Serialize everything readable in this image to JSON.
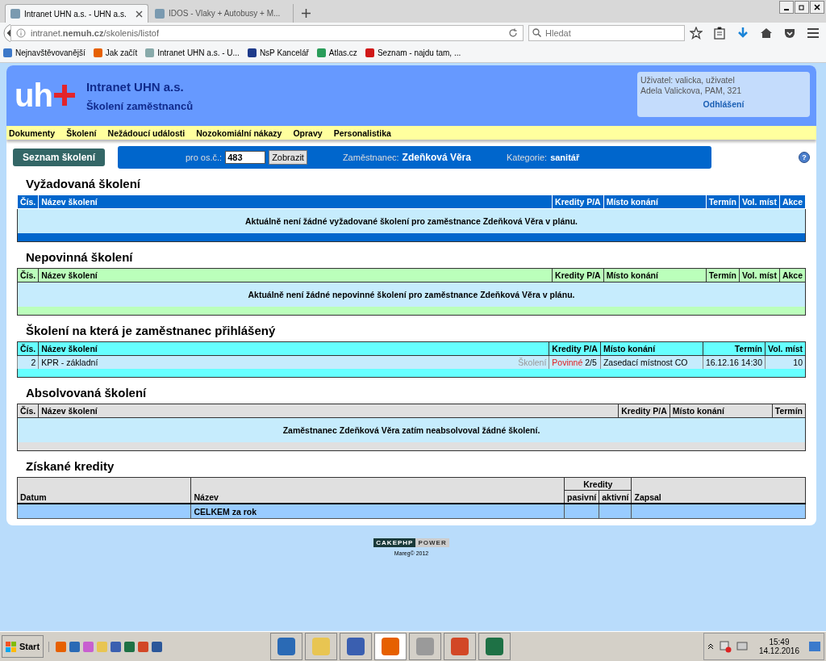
{
  "browser": {
    "tabs": [
      {
        "title": "Intranet UHN a.s. - UHN a.s.",
        "selected": true
      },
      {
        "title": "IDOS - Vlaky + Autobusy + M...",
        "selected": false
      }
    ],
    "address": "intranet.**nemuh.cz**/skolenis/listof",
    "search_placeholder": "Hledat",
    "bookmarks": [
      "Nejnavštěvovanější",
      "Jak začít",
      "Intranet UHN a.s. - U...",
      "NsP Kancelář",
      "Atlas.cz",
      "Seznam - najdu tam, ..."
    ]
  },
  "header": {
    "logo": "uh",
    "title": "Intranet UHN a.s.",
    "subtitle": "Školení zaměstnanců",
    "user_lines": [
      "Uživatel: valicka, uživatel",
      "Adela Valickova, PAM, 321"
    ],
    "logout": "Odhlášení"
  },
  "menu": [
    "Dokumenty",
    "Školení",
    "Nežádoucí události",
    "Nozokomiální nákazy",
    "Opravy",
    "Personalistika"
  ],
  "toolbar": {
    "list_button": "Seznam školení",
    "number_label": "pro os.č.:",
    "number_value": "483",
    "show_button": "Zobrazit",
    "employee_label": "Zaměstnanec:",
    "employee": "Zdeňková Věra",
    "category_label": "Kategorie:",
    "category": "sanitář",
    "help": "?"
  },
  "sections": [
    {
      "kind": "required",
      "title": "Vyžadovaná školení",
      "columns": [
        "Čís.",
        "Název školení",
        "Kredity P/A",
        "Místo konání",
        "Termín",
        "Vol. míst",
        "Akce"
      ],
      "message": "Aktuálně není žádné vyžadované školení pro zaměstnance Zdeňková Věra v plánu."
    },
    {
      "kind": "optional",
      "title": "Nepovinná školení",
      "columns": [
        "Čís.",
        "Název školení",
        "Kredity P/A",
        "Místo konání",
        "Termín",
        "Vol. míst",
        "Akce"
      ],
      "message": "Aktuálně není žádné nepovinné školení pro zaměstnance Zdeňková Věra v plánu."
    },
    {
      "kind": "registered",
      "title": "Školení na která je zaměstnanec přihlášený",
      "columns": [
        "Čís.",
        "Název školení",
        "Kredity P/A",
        "Místo konání",
        "Termín",
        "Vol. míst"
      ],
      "rows": [
        {
          "number": "2",
          "name": "KPR - základní",
          "type": "Školení",
          "credit_type": "Povinné",
          "credits": "2/5",
          "place": "Zasedací místnost CO",
          "date": "16.12.16 14:30",
          "seats": "10"
        }
      ]
    },
    {
      "kind": "completed",
      "title": "Absolvovaná školení",
      "columns": [
        "Čís.",
        "Název školení",
        "Kredity P/A",
        "Místo konání",
        "Termín"
      ],
      "message": "Zaměstnanec Zdeňková Věra zatím neabsolvoval žádné školení."
    }
  ],
  "credits": {
    "title": "Získané kredity",
    "date": "Datum",
    "name": "Název",
    "group": "Kredity",
    "passive": "pasivní",
    "active": "aktivní",
    "recorded": "Zapsal",
    "total": "CELKEM za rok"
  },
  "footer": {
    "badge_left": "CAKEPHP",
    "badge_right": "POWER",
    "copyright": "Mareg© 2012"
  },
  "taskbar": {
    "start": "Start",
    "quick_launch": [
      {
        "kind": "firefox"
      },
      {
        "kind": "thunderbird"
      },
      {
        "kind": "paint"
      },
      {
        "kind": "folder"
      },
      {
        "kind": "v4"
      },
      {
        "kind": "excel"
      },
      {
        "kind": "powerpoint"
      },
      {
        "kind": "word"
      }
    ],
    "tasks": [
      {
        "kind": "thunderbird",
        "selected": false
      },
      {
        "kind": "folder",
        "selected": false
      },
      {
        "kind": "v4",
        "selected": false
      },
      {
        "kind": "firefox",
        "selected": true
      },
      {
        "kind": "printer",
        "selected": false
      },
      {
        "kind": "powerpoint",
        "selected": false
      },
      {
        "kind": "excel",
        "selected": false
      }
    ],
    "time": "15:49",
    "date": "14.12.2016"
  }
}
